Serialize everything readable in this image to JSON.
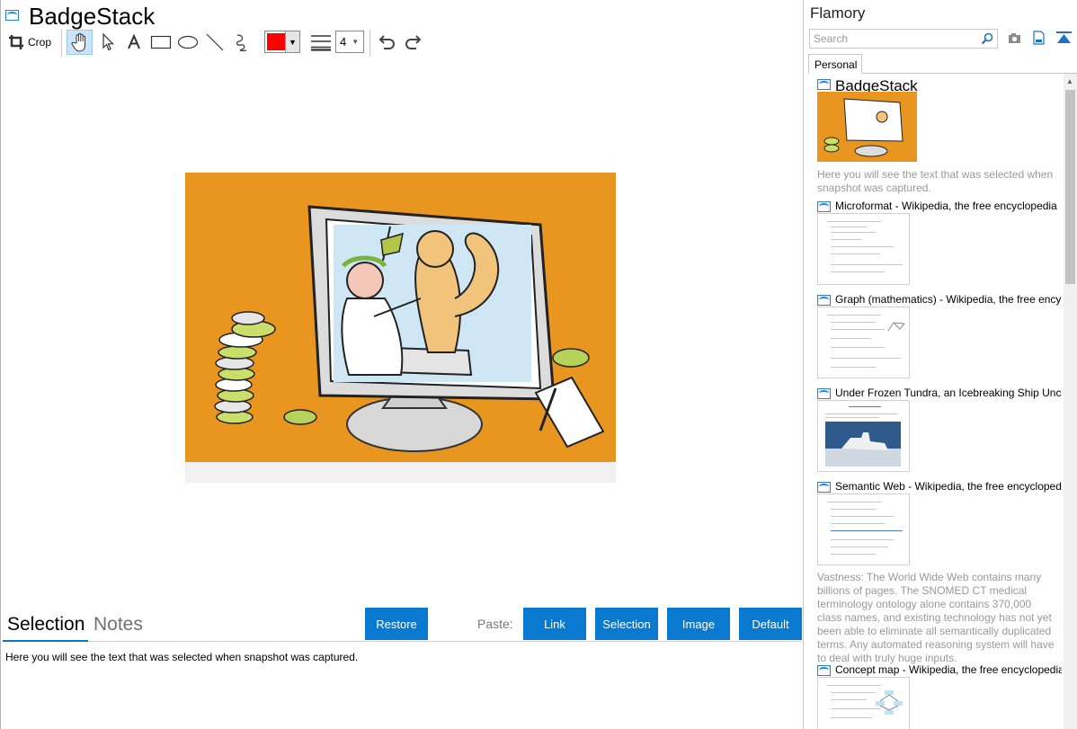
{
  "app": {
    "title": "BadgeStack"
  },
  "toolbar": {
    "crop_label": "Crop",
    "line_width_value": "4",
    "stroke_color": "#ff0000",
    "tools": [
      "hand-icon",
      "select-arrow-icon",
      "text-icon",
      "rectangle-icon",
      "ellipse-icon",
      "line-icon",
      "freehand-icon",
      "line-width-icon",
      "undo-icon",
      "redo-icon"
    ]
  },
  "bottom": {
    "tabs": [
      {
        "label": "Selection"
      },
      {
        "label": "Notes"
      }
    ],
    "restore_label": "Restore",
    "paste_label": "Paste:",
    "paste_buttons": [
      {
        "label": "Link"
      },
      {
        "label": "Selection"
      },
      {
        "label": "Image"
      },
      {
        "label": "Default"
      }
    ],
    "selection_text": "Here you will see the text that was selected when snapshot was captured."
  },
  "sidebar": {
    "title": "Flamory",
    "search_placeholder": "Search",
    "tab_label": "Personal",
    "snapshots": [
      {
        "title": "BadgeStack",
        "text": "Here you will see the text that was selected when snapshot was captured."
      },
      {
        "title": "Microformat - Wikipedia, the free encyclopedia",
        "text": ""
      },
      {
        "title": "Graph (mathematics) - Wikipedia, the free ency",
        "text": ""
      },
      {
        "title": "Under Frozen Tundra, an Icebreaking Ship Unco",
        "text": ""
      },
      {
        "title": "Semantic Web - Wikipedia, the free encycloped",
        "text": "Vastness: The World Wide Web contains many billions of pages. The SNOMED CT medical terminology ontology alone contains 370,000 class names, and existing technology has not yet been able to eliminate all semantically duplicated terms. Any automated reasoning system will have to deal with truly huge inputs."
      },
      {
        "title": "Concept map - Wikipedia, the free encyclopedia",
        "text": ""
      }
    ]
  },
  "colors": {
    "accent": "#0a7ad1",
    "illustration_bg": "#e8961f"
  }
}
